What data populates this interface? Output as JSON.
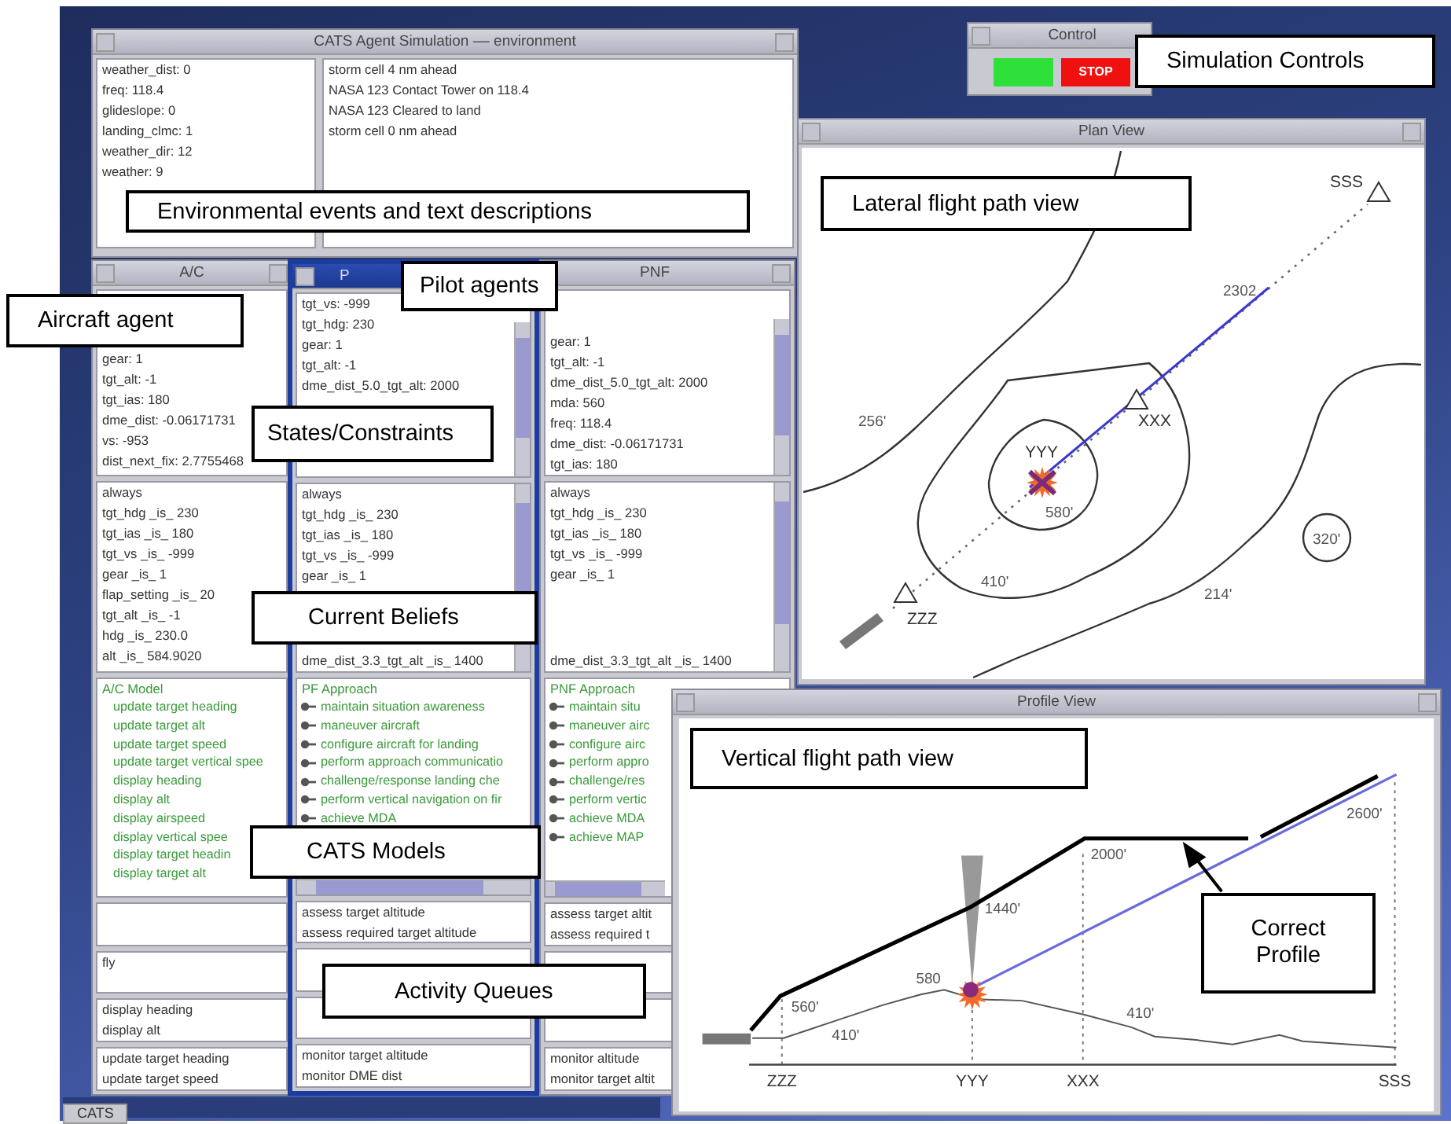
{
  "environment_window": {
    "title": "CATS Agent Simulation –– environment",
    "variables": [
      "weather_dist: 0",
      "freq: 118.4",
      "glideslope: 0",
      "landing_clmc: 1",
      "weather_dir: 12",
      "weather: 9"
    ],
    "messages": [
      "storm cell 4 nm ahead",
      "NASA 123 Contact Tower on 118.4",
      "NASA 123 Cleared to land",
      "storm cell 0 nm ahead"
    ]
  },
  "control_window": {
    "title": "Control",
    "buttons": [
      {
        "kind": "go"
      },
      {
        "kind": "stop",
        "label": "STOP"
      }
    ]
  },
  "agent_windows": [
    {
      "title": "A/C",
      "focused": false,
      "scrollbars": false,
      "states": {
        "end_lines": [
          "gear: 1",
          "tgt_alt: -1",
          "tgt_ias: 180",
          "dme_dist: -0.06171731",
          "vs: -953",
          "dist_next_fix: 2.7755468"
        ]
      },
      "beliefs": {
        "lines": [
          "always",
          "tgt_hdg _is_ 230",
          "tgt_ias _is_ 180",
          "tgt_vs _is_ -999",
          "gear _is_ 1",
          "flap_setting _is_ 20",
          "tgt_alt _is_ -1",
          "hdg _is_ 230.0",
          "alt _is_ 584.9020"
        ]
      },
      "model": {
        "title": "A/C Model",
        "bulleted": false,
        "items": [
          "update target heading",
          "update target alt",
          "update target speed",
          "update target vertical spee",
          "display heading",
          "display alt",
          "display airspeed",
          "display vertical spee",
          "display target headin",
          "display target alt"
        ]
      },
      "queues": [
        {
          "kind": "empty"
        },
        {
          "kind": "list",
          "lines": [
            "fly"
          ]
        },
        {
          "kind": "list",
          "lines": [
            "display heading",
            "display alt"
          ]
        },
        {
          "kind": "list",
          "lines": [
            "update target heading",
            "update target speed"
          ]
        }
      ]
    },
    {
      "title": "P",
      "focused": true,
      "scrollbars": true,
      "states": {
        "lines": [
          "tgt_vs: -999",
          "tgt_hdg: 230",
          "gear: 1",
          "tgt_alt: -1",
          "dme_dist_5.0_tgt_alt: 2000"
        ]
      },
      "beliefs": {
        "lines": [
          "always",
          "tgt_hdg _is_ 230",
          "tgt_ias _is_ 180",
          "tgt_vs _is_ -999",
          "gear _is_ 1"
        ],
        "end_lines": [
          "dme_dist_3.3_tgt_alt _is_ 1400"
        ]
      },
      "model": {
        "title": "PF Approach",
        "bulleted": true,
        "items": [
          "maintain situation awareness",
          "maneuver aircraft",
          "configure aircraft for landing",
          "perform approach communicatio",
          "challenge/response landing che",
          "perform vertical navigation on fir",
          "achieve MDA"
        ]
      },
      "queues": [
        {
          "kind": "list",
          "lines": [
            "assess target altitude",
            "assess required target altitude"
          ]
        },
        {
          "kind": "empty"
        },
        {
          "kind": "empty"
        },
        {
          "kind": "list",
          "lines": [
            "monitor target altitude",
            "monitor DME dist"
          ]
        }
      ]
    },
    {
      "title": "PNF",
      "focused": false,
      "scrollbars": true,
      "states": {
        "end_lines": [
          "gear: 1",
          "tgt_alt: -1",
          "dme_dist_5.0_tgt_alt: 2000",
          "mda: 560",
          "freq: 118.4",
          "dme_dist: -0.06171731",
          "tgt_ias: 180"
        ]
      },
      "beliefs": {
        "lines": [
          "always",
          "tgt_hdg _is_ 230",
          "tgt_ias _is_ 180",
          "tgt_vs _is_ -999",
          "gear _is_ 1"
        ],
        "end_lines": [
          "dme_dist_3.3_tgt_alt _is_ 1400"
        ]
      },
      "model": {
        "title": "PNF Approach",
        "bulleted": true,
        "items": [
          "maintain situ",
          "maneuver airc",
          "configure airc",
          "perform appro",
          "challenge/res",
          "perform vertic",
          "achieve MDA",
          "achieve MAP"
        ]
      },
      "queues": [
        {
          "kind": "list",
          "lines": [
            "assess target altit",
            "assess required t"
          ]
        },
        {
          "kind": "empty"
        },
        {
          "kind": "empty"
        },
        {
          "kind": "list",
          "lines": [
            "monitor altitude",
            "monitor target altit"
          ]
        }
      ]
    }
  ],
  "plan_view": {
    "title": "Plan View",
    "labels": [
      "SSS",
      "2302",
      "XXX",
      "YYY",
      "256'",
      "580'",
      "410'",
      "214'",
      "320'",
      "ZZZ"
    ]
  },
  "profile_view": {
    "title": "Profile View",
    "altitudes": [
      "2600'",
      "2000'",
      "1440'",
      "580",
      "560'",
      "410'",
      "410'"
    ],
    "waypoints": [
      "ZZZ",
      "YYY",
      "XXX",
      "SSS"
    ]
  },
  "taskbar": {
    "items": [
      {
        "label": "CATS"
      }
    ]
  },
  "callouts": [
    "Environmental events and text descriptions",
    "Simulation Controls",
    "Lateral flight path view",
    "Aircraft agent",
    "Pilot agents",
    "States/Constraints",
    "Current Beliefs",
    "CATS Models",
    "Activity Queues",
    "Vertical flight path view",
    "Correct Profile"
  ]
}
